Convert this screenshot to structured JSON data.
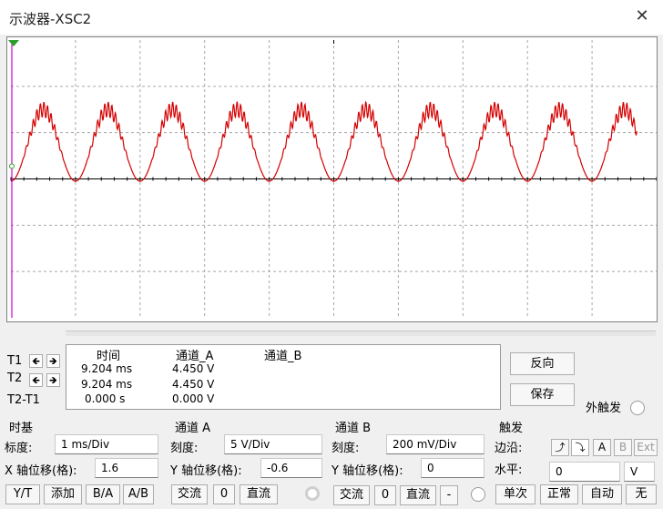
{
  "window": {
    "title": "示波器-XSC2",
    "close_glyph": "✕"
  },
  "cursors": {
    "t1_label": "T1",
    "t2_label": "T2",
    "t2t1_label": "T2-T1",
    "left_arrow": "🡸",
    "right_arrow": "🡺"
  },
  "readout": {
    "headers": {
      "time": "时间",
      "channel_a": "通道_A",
      "channel_b": "通道_B"
    },
    "rows": [
      {
        "time": "9.204 ms",
        "a": "4.450 V",
        "b": ""
      },
      {
        "time": "9.204 ms",
        "a": "4.450 V",
        "b": ""
      },
      {
        "time": "0.000 s",
        "a": "0.000 V",
        "b": ""
      }
    ]
  },
  "side_buttons": {
    "reverse": "反向",
    "save": "保存",
    "ext_trigger": "外触发"
  },
  "timebase": {
    "title": "时基",
    "scale_label": "标度:",
    "scale_value": "1 ms/Div",
    "xpos_label": "X 轴位移(格):",
    "xpos_value": "1.6",
    "yt": "Y/T",
    "add": "添加",
    "ba": "B/A",
    "ab": "A/B"
  },
  "channel_a": {
    "title": "通道 A",
    "scale_label": "刻度:",
    "scale_value": "5  V/Div",
    "ypos_label": "Y 轴位移(格):",
    "ypos_value": "-0.6",
    "ac": "交流",
    "zero": "0",
    "dc": "直流"
  },
  "channel_b": {
    "title": "通道 B",
    "scale_label": "刻度:",
    "scale_value": "200 mV/Div",
    "ypos_label": "Y 轴位移(格):",
    "ypos_value": "0",
    "ac": "交流",
    "zero": "0",
    "dc": "直流",
    "minus": "-"
  },
  "trigger": {
    "title": "触发",
    "edge_label": "边沿:",
    "rise_glyph": "⤴",
    "fall_glyph": "⤵",
    "a": "A",
    "b": "B",
    "ext": "Ext",
    "level_label": "水平:",
    "level_value": "0",
    "level_unit": "V",
    "single": "单次",
    "normal": "正常",
    "auto": "自动",
    "none": "无"
  },
  "colors": {
    "trace_a": "#d40000",
    "cursor_t1": "#d400d4",
    "grid": "#a8a8a8"
  },
  "chart_data": {
    "type": "line",
    "series": [
      {
        "name": "",
        "waveform": "rectified-sine with high-frequency ripple near peaks",
        "period_div": 1.0,
        "peak_div": 1.5,
        "valley_div": -0.05,
        "start_div": 0.0,
        "end_div": 9.7
      }
    ],
    "grid": true,
    "x_divisions": 10,
    "y_divisions": 6
  }
}
